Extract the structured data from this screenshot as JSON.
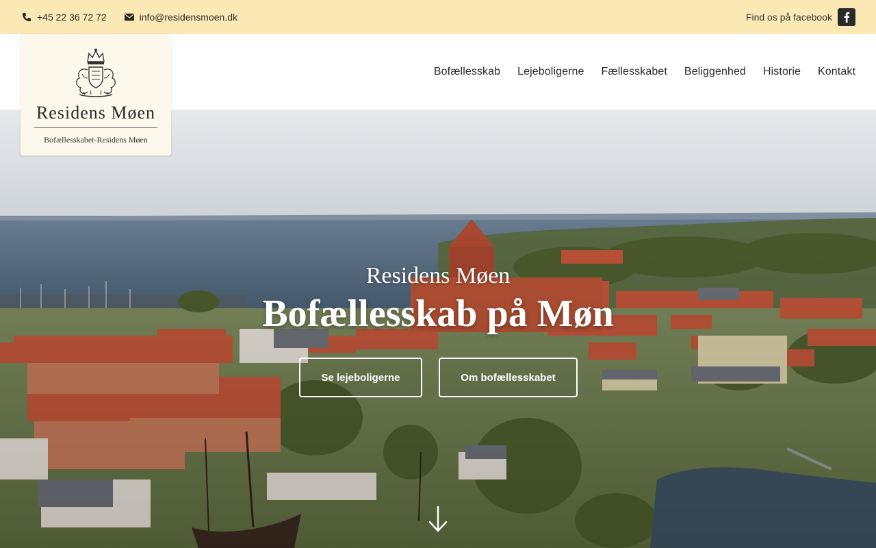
{
  "topbar": {
    "phone": "+45 22 36 72 72",
    "email": "info@residensmoen.dk",
    "facebook_text": "Find os på facebook",
    "phone_icon": "phone-icon",
    "email_icon": "envelope-icon",
    "facebook_icon": "facebook-icon"
  },
  "logo": {
    "name": "Residens Møen",
    "subtitle": "Bofællesskabet-Residens Møen",
    "crest_icon": "crest-icon"
  },
  "nav": {
    "items": [
      {
        "label": "Bofællesskab"
      },
      {
        "label": "Lejeboligerne"
      },
      {
        "label": "Fællesskabet"
      },
      {
        "label": "Beliggenhed"
      },
      {
        "label": "Historie"
      },
      {
        "label": "Kontakt"
      }
    ]
  },
  "hero": {
    "kicker": "Residens Møen",
    "title": "Bofællesskab på Møn",
    "primary_button": "Se lejeboligerne",
    "secondary_button": "Om bofællesskabet",
    "scroll_icon": "arrow-down-icon"
  },
  "colors": {
    "topbar_bg": "#fae9b5",
    "logo_bg": "#fdf8ec",
    "text_dark": "#2a2a2a",
    "roof_red": "#c2553a",
    "water": "#4f6a82"
  }
}
